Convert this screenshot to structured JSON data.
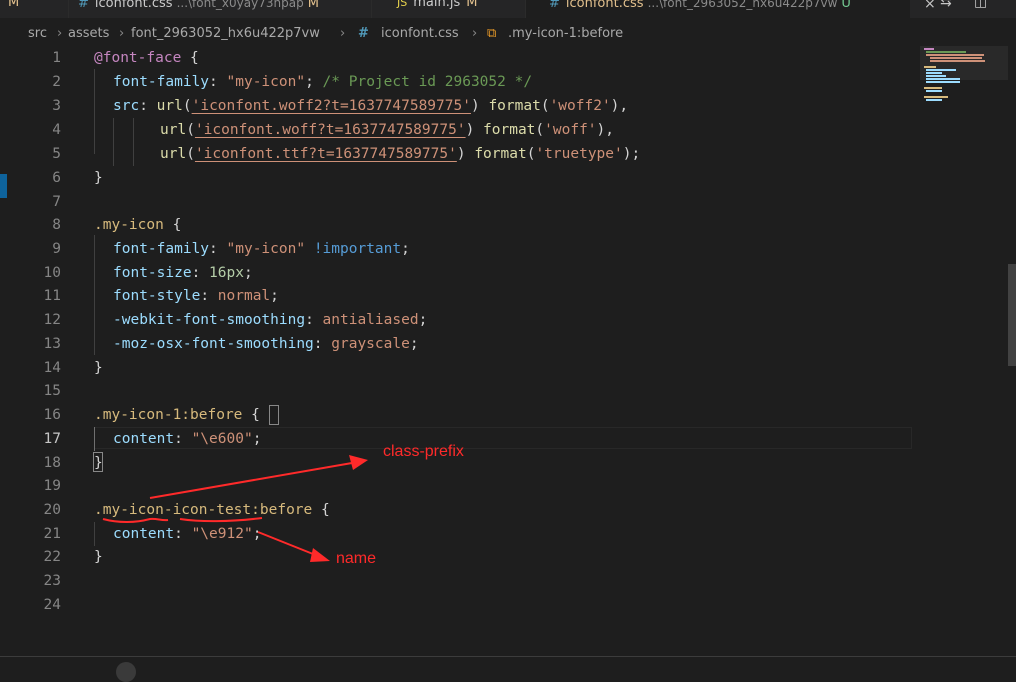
{
  "tabs": [
    {
      "icon": "#",
      "name": "",
      "desc": "",
      "modified": "M"
    },
    {
      "icon": "#",
      "name": "iconfont.css",
      "desc": "...\\font_x0yay73hpap",
      "modified": "M"
    },
    {
      "icon": "JS",
      "name": "main.js",
      "desc": "",
      "modified": "M"
    },
    {
      "icon": "#",
      "name": "iconfont.css",
      "desc": "...\\font_2963052_hx6u422p7vw",
      "modified": "U"
    }
  ],
  "breadcrumb": {
    "items": [
      "src",
      "assets",
      "font_2963052_hx6u422p7vw",
      "iconfont.css",
      ".my-icon-1:before"
    ],
    "file_icon": "#"
  },
  "editor": {
    "current_line": 17,
    "line_numbers": [
      "1",
      "2",
      "3",
      "4",
      "5",
      "6",
      "7",
      "8",
      "9",
      "10",
      "11",
      "12",
      "13",
      "14",
      "15",
      "16",
      "17",
      "18",
      "19",
      "20",
      "21",
      "22",
      "23",
      "24"
    ],
    "lines": {
      "l1": {
        "at": "@font-face",
        "p": " {"
      },
      "l2": {
        "prop": "font-family",
        "p1": ": ",
        "str": "\"my-icon\"",
        "p2": "; ",
        "com": "/* Project id 2963052 */"
      },
      "l3": {
        "prop": "src",
        "p1": ": ",
        "f1": "url",
        "p2": "(",
        "s1": "'iconfont.woff2?t=1637747589775'",
        "p3": ") ",
        "f2": "format",
        "p4": "(",
        "s2": "'woff2'",
        "p5": "),"
      },
      "l4": {
        "f1": "url",
        "p2": "(",
        "s1": "'iconfont.woff?t=1637747589775'",
        "p3": ") ",
        "f2": "format",
        "p4": "(",
        "s2": "'woff'",
        "p5": "),"
      },
      "l5": {
        "f1": "url",
        "p2": "(",
        "s1": "'iconfont.ttf?t=1637747589775'",
        "p3": ") ",
        "f2": "format",
        "p4": "(",
        "s2": "'truetype'",
        "p5": ");"
      },
      "l6": {
        "p": "}"
      },
      "l8": {
        "sel": ".my-icon",
        "p": " {"
      },
      "l9": {
        "prop": "font-family",
        "p1": ": ",
        "str": "\"my-icon\"",
        "sp": " ",
        "imp": "!important",
        "p2": ";"
      },
      "l10": {
        "prop": "font-size",
        "p1": ": ",
        "num": "16px",
        "p2": ";"
      },
      "l11": {
        "prop": "font-style",
        "p1": ": ",
        "val": "normal",
        "p2": ";"
      },
      "l12": {
        "prop": "-webkit-font-smoothing",
        "p1": ": ",
        "val": "antialiased",
        "p2": ";"
      },
      "l13": {
        "prop": "-moz-osx-font-smoothing",
        "p1": ": ",
        "val": "grayscale",
        "p2": ";"
      },
      "l14": {
        "p": "}"
      },
      "l16": {
        "sel": ".my-icon-1:before",
        "sp": " ",
        "p": "{"
      },
      "l17": {
        "prop": "content",
        "p1": ": ",
        "str": "\"\\e600\"",
        "p2": ";"
      },
      "l18": {
        "p": "}"
      },
      "l20": {
        "sel1": ".my-icon-",
        "sel2": "icon-test",
        "sel3": ":before",
        "p": " {"
      },
      "l21": {
        "prop": "content",
        "p1": ": ",
        "str": "\"\\e912\"",
        "p2": ";"
      },
      "l22": {
        "p": "}"
      }
    }
  },
  "annotations": {
    "class_prefix": "class-prefix",
    "name": "name",
    "color": "#ff2a2a"
  },
  "colors": {
    "background": "#1e1e1e",
    "keyword": "#c586c0",
    "selector": "#d7ba7d",
    "property": "#9cdcfe",
    "string": "#ce9178",
    "comment": "#6a9955",
    "number": "#b5cea8",
    "function": "#dcdcaa",
    "important": "#569cd6"
  }
}
